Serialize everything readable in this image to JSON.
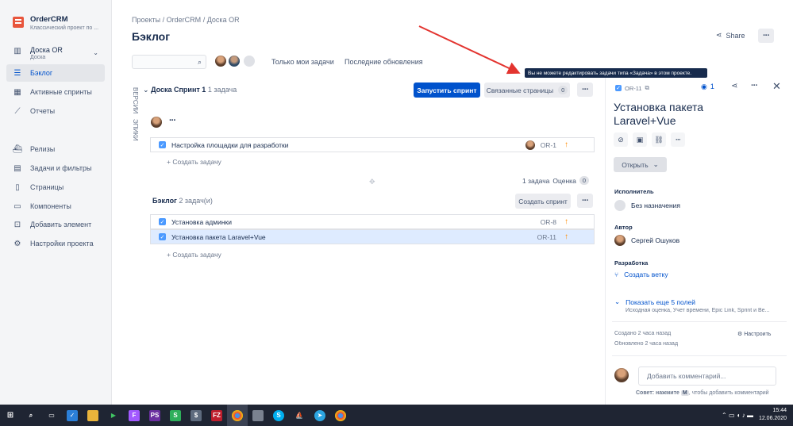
{
  "sidebar": {
    "project_name": "OrderCRM",
    "project_sub": "Классический проект по ...",
    "board_name": "Доска OR",
    "board_sub": "Доска",
    "items": [
      {
        "label": "Бэклог",
        "icon": "backlog-icon"
      },
      {
        "label": "Активные спринты",
        "icon": "board-icon"
      },
      {
        "label": "Отчеты",
        "icon": "reports-icon"
      },
      {
        "label": "Релизы",
        "icon": "ship-icon"
      },
      {
        "label": "Задачи и фильтры",
        "icon": "filter-icon"
      },
      {
        "label": "Страницы",
        "icon": "page-icon"
      },
      {
        "label": "Компоненты",
        "icon": "component-icon"
      },
      {
        "label": "Добавить элемент",
        "icon": "add-item-icon"
      },
      {
        "label": "Настройки проекта",
        "icon": "gear-icon"
      }
    ]
  },
  "breadcrumb": {
    "p1": "Проекты",
    "p2": "OrderCRM",
    "p3": "Доска OR",
    "sep": "/"
  },
  "page_title": "Бэклог",
  "share_label": "Share",
  "filters": {
    "only_mine": "Только мои задачи",
    "recent": "Последние обновления"
  },
  "vertical_tabs": {
    "versions": "ВЕРСИИ",
    "epics": "ЭПИКИ"
  },
  "sprint": {
    "name": "Доска Спринт 1",
    "count": "1 задача",
    "start_label": "Запустить спринт",
    "linked_label": "Связанные страницы",
    "linked_count": "0",
    "issues": [
      {
        "title": "Настройка площадки для разработки",
        "key": "OR-1"
      }
    ],
    "create_label": "+ Создать задачу",
    "summary_count": "1 задача",
    "estimate_label": "Оценка",
    "estimate_value": "0"
  },
  "backlog": {
    "name": "Бэклог",
    "count": "2 задач(и)",
    "create_sprint_label": "Создать спринт",
    "issues": [
      {
        "title": "Установка админки",
        "key": "OR-8"
      },
      {
        "title": "Установка пакета Laravel+Vue",
        "key": "OR-11"
      }
    ],
    "create_label": "+ Создать задачу"
  },
  "tooltip": "Вы не можете редактировать задачи типа «Задача» в этом проекте.",
  "panel": {
    "key": "OR-11",
    "watch_count": "1",
    "title": "Установка пакета Laravel+Vue",
    "status": "Открыть",
    "assignee_label": "Исполнитель",
    "assignee": "Без назначения",
    "author_label": "Автор",
    "author": "Сергей Ошуков",
    "dev_label": "Разработка",
    "create_branch": "Создать ветку",
    "more_fields": "Показать еще 5 полей",
    "more_fields_sub": "Исходная оценка, Учет времени, Epic Link, Sprint и Ве...",
    "created": "Создано 2 часа назад",
    "updated": "Обновлено 2 часа назад",
    "configure": "Настроить",
    "comment_placeholder": "Добавить комментарий...",
    "tip_prefix": "Совет: нажмите",
    "tip_key": "M",
    "tip_suffix": ", чтобы добавить комментарий"
  },
  "taskbar": {
    "time": "15:44",
    "date": "12.06.2020"
  },
  "colors": {
    "accent": "#0052cc",
    "priority": "#ff8b00",
    "arrow": "#e3342f"
  }
}
